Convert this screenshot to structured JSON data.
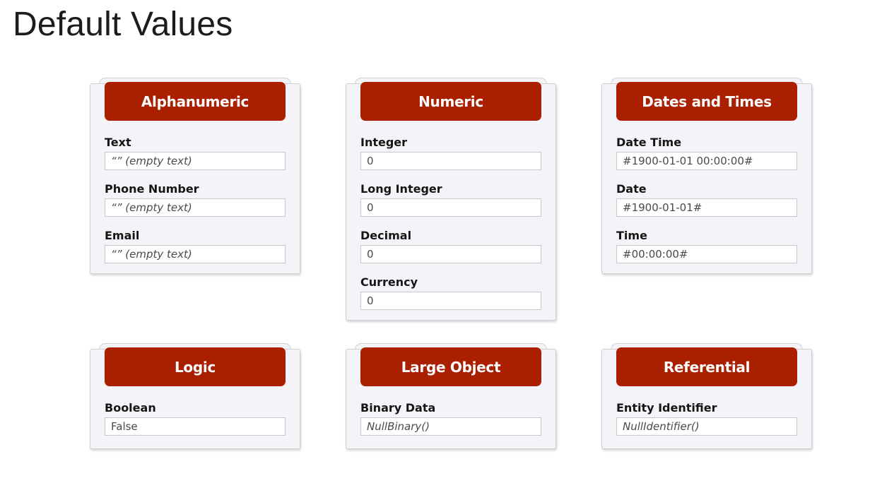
{
  "page": {
    "title": "Default Values"
  },
  "cards": [
    {
      "title": "Alphanumeric",
      "fields": [
        {
          "label": "Text",
          "value": "“” (empty text)"
        },
        {
          "label": "Phone Number",
          "value": "“” (empty text)"
        },
        {
          "label": "Email",
          "value": "“” (empty text)"
        }
      ]
    },
    {
      "title": "Numeric",
      "fields": [
        {
          "label": "Integer",
          "value": "0"
        },
        {
          "label": "Long Integer",
          "value": "0"
        },
        {
          "label": "Decimal",
          "value": "0"
        },
        {
          "label": "Currency",
          "value": "0"
        }
      ]
    },
    {
      "title": "Dates and Times",
      "fields": [
        {
          "label": "Date Time",
          "value": "#1900-01-01 00:00:00#"
        },
        {
          "label": "Date",
          "value": "#1900-01-01#"
        },
        {
          "label": "Time",
          "value": "#00:00:00#"
        }
      ]
    },
    {
      "title": "Logic",
      "fields": [
        {
          "label": "Boolean",
          "value": "False"
        }
      ]
    },
    {
      "title": "Large Object",
      "fields": [
        {
          "label": "Binary Data",
          "value": "NullBinary()"
        }
      ]
    },
    {
      "title": "Referential",
      "fields": [
        {
          "label": "Entity Identifier",
          "value": "NullIdentifier()"
        }
      ]
    }
  ],
  "colors": {
    "header_background": "#aa1f00",
    "header_text": "#ffffff",
    "card_background": "#f4f4f8",
    "field_border": "#c7c7cf"
  }
}
